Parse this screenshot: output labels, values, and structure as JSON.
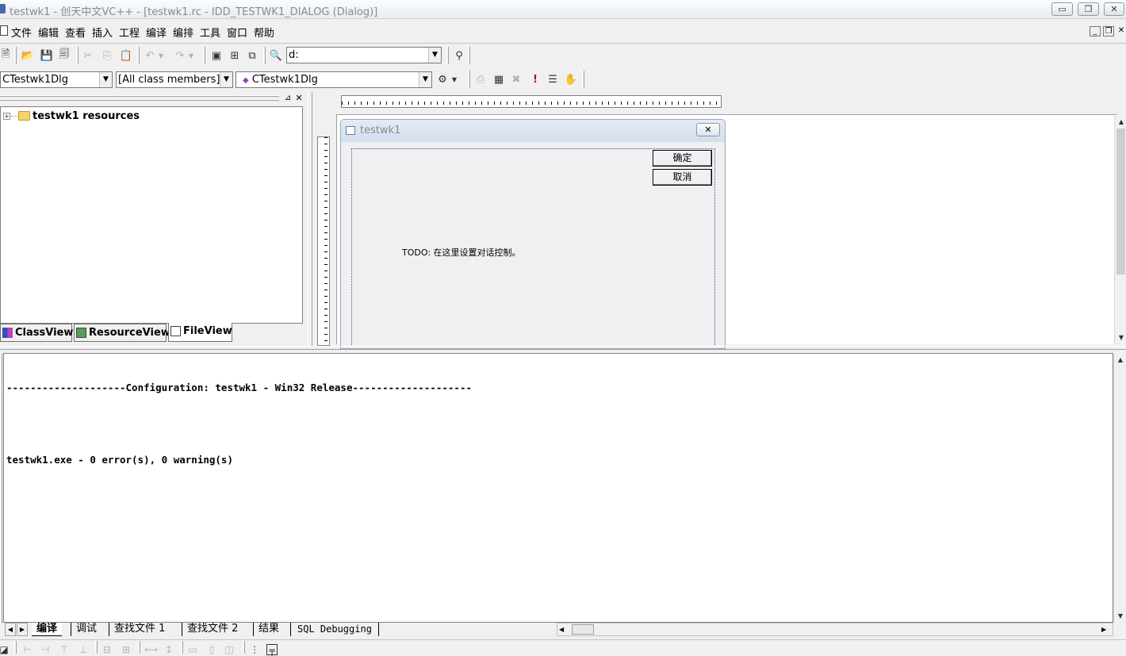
{
  "window": {
    "title": "testwk1 - 创天中文VC++ - [testwk1.rc - IDD_TESTWK1_DIALOG (Dialog)]",
    "min_glyph": "▭",
    "max_glyph": "❐",
    "close_glyph": "✕"
  },
  "menu": {
    "items": [
      "文件",
      "编辑",
      "查看",
      "插入",
      "工程",
      "编译",
      "编排",
      "工具",
      "窗口",
      "帮助"
    ]
  },
  "toolbar": {
    "directory_combo_value": "d:"
  },
  "wizardbar": {
    "class_combo_value": "CTestwk1Dlg",
    "filter_combo_value": "[All class members]",
    "member_combo_value": "CTestwk1Dlg"
  },
  "workspace": {
    "tree_root_label": "testwk1 resources",
    "expand_glyph": "+",
    "tabs": [
      "ClassView",
      "ResourceView",
      "FileView"
    ]
  },
  "dialog_editor": {
    "dialog_title": "testwk1",
    "ok_button_label": "确定",
    "cancel_button_label": "取消",
    "static_text": "TODO: 在这里设置对话控制。"
  },
  "output": {
    "lines": [
      "--------------------Configuration: testwk1 - Win32 Release--------------------",
      "",
      "testwk1.exe - 0 error(s), 0 warning(s)"
    ],
    "tabs": [
      "编译",
      "调试",
      "查找文件 1",
      "查找文件 2",
      "结果",
      "SQL Debugging"
    ],
    "active_tab_index": 0
  },
  "colors": {
    "accent": "#3a4ab0",
    "background": "#f0f0f0",
    "red_exclamation": "#c00000"
  }
}
